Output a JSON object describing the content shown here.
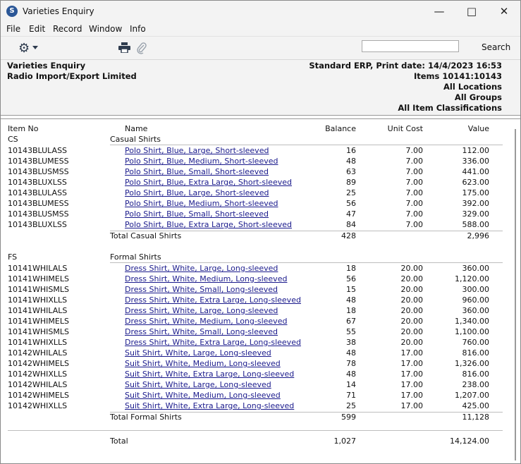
{
  "window": {
    "title": "Varieties Enquiry",
    "app_icon_glyph": "S"
  },
  "menu": [
    "File",
    "Edit",
    "Record",
    "Window",
    "Info"
  ],
  "toolbar": {
    "search_label": "Search",
    "search_value": ""
  },
  "header": {
    "report_name": "Varieties Enquiry",
    "company": "Radio Import/Export Limited",
    "system_line": "Standard ERP, Print date:  14/4/2023 16:53",
    "items_line": "Items  10141:10143",
    "locations": "All Locations",
    "groups": "All Groups",
    "classifications": "All Item Classifications"
  },
  "columns": {
    "item_no": "Item No",
    "name": "Name",
    "balance": "Balance",
    "unit_cost": "Unit Cost",
    "value": "Value"
  },
  "groups": [
    {
      "code": "CS",
      "name": "Casual Shirts",
      "rows": [
        {
          "code": "10143BLULASS",
          "name": "Polo Shirt, Blue, Large, Short-sleeved",
          "balance": "16",
          "cost": "7.00",
          "value": "112.00"
        },
        {
          "code": "10143BLUMESS",
          "name": "Polo Shirt, Blue, Medium, Short-sleeved",
          "balance": "48",
          "cost": "7.00",
          "value": "336.00"
        },
        {
          "code": "10143BLUSMSS",
          "name": "Polo Shirt, Blue, Small, Short-sleeved",
          "balance": "63",
          "cost": "7.00",
          "value": "441.00"
        },
        {
          "code": "10143BLUXLSS",
          "name": "Polo Shirt, Blue, Extra Large, Short-sleeved",
          "balance": "89",
          "cost": "7.00",
          "value": "623.00"
        },
        {
          "code": "10143BLULASS",
          "name": "Polo Shirt, Blue, Large, Short-sleeved",
          "balance": "25",
          "cost": "7.00",
          "value": "175.00"
        },
        {
          "code": "10143BLUMESS",
          "name": "Polo Shirt, Blue, Medium, Short-sleeved",
          "balance": "56",
          "cost": "7.00",
          "value": "392.00"
        },
        {
          "code": "10143BLUSMSS",
          "name": "Polo Shirt, Blue, Small, Short-sleeved",
          "balance": "47",
          "cost": "7.00",
          "value": "329.00"
        },
        {
          "code": "10143BLUXLSS",
          "name": "Polo Shirt, Blue, Extra Large, Short-sleeved",
          "balance": "84",
          "cost": "7.00",
          "value": "588.00"
        }
      ],
      "total_label": "Total Casual Shirts",
      "total_balance": "428",
      "total_value": "2,996"
    },
    {
      "code": "FS",
      "name": "Formal Shirts",
      "rows": [
        {
          "code": "10141WHILALS",
          "name": "Dress Shirt, White, Large, Long-sleeved",
          "balance": "18",
          "cost": "20.00",
          "value": "360.00"
        },
        {
          "code": "10141WHIMELS",
          "name": "Dress Shirt, White, Medium, Long-sleeved",
          "balance": "56",
          "cost": "20.00",
          "value": "1,120.00"
        },
        {
          "code": "10141WHISMLS",
          "name": "Dress Shirt, White, Small, Long-sleeved",
          "balance": "15",
          "cost": "20.00",
          "value": "300.00"
        },
        {
          "code": "10141WHIXLLS",
          "name": "Dress Shirt, White, Extra Large, Long-sleeved",
          "balance": "48",
          "cost": "20.00",
          "value": "960.00"
        },
        {
          "code": "10141WHILALS",
          "name": "Dress Shirt, White, Large, Long-sleeved",
          "balance": "18",
          "cost": "20.00",
          "value": "360.00"
        },
        {
          "code": "10141WHIMELS",
          "name": "Dress Shirt, White, Medium, Long-sleeved",
          "balance": "67",
          "cost": "20.00",
          "value": "1,340.00"
        },
        {
          "code": "10141WHISMLS",
          "name": "Dress Shirt, White, Small, Long-sleeved",
          "balance": "55",
          "cost": "20.00",
          "value": "1,100.00"
        },
        {
          "code": "10141WHIXLLS",
          "name": "Dress Shirt, White, Extra Large, Long-sleeved",
          "balance": "38",
          "cost": "20.00",
          "value": "760.00"
        },
        {
          "code": "10142WHILALS",
          "name": "Suit Shirt, White, Large, Long-sleeved",
          "balance": "48",
          "cost": "17.00",
          "value": "816.00"
        },
        {
          "code": "10142WHIMELS",
          "name": "Suit Shirt, White, Medium, Long-sleeved",
          "balance": "78",
          "cost": "17.00",
          "value": "1,326.00"
        },
        {
          "code": "10142WHIXLLS",
          "name": "Suit Shirt, White, Extra Large, Long-sleeved",
          "balance": "48",
          "cost": "17.00",
          "value": "816.00"
        },
        {
          "code": "10142WHILALS",
          "name": "Suit Shirt, White, Large, Long-sleeved",
          "balance": "14",
          "cost": "17.00",
          "value": "238.00"
        },
        {
          "code": "10142WHIMELS",
          "name": "Suit Shirt, White, Medium, Long-sleeved",
          "balance": "71",
          "cost": "17.00",
          "value": "1,207.00"
        },
        {
          "code": "10142WHIXLLS",
          "name": "Suit Shirt, White, Extra Large, Long-sleeved",
          "balance": "25",
          "cost": "17.00",
          "value": "425.00"
        }
      ],
      "total_label": "Total Formal Shirts",
      "total_balance": "599",
      "total_value": "11,128"
    }
  ],
  "grand_total": {
    "label": "Total",
    "balance": "1,027",
    "value": "14,124.00"
  }
}
